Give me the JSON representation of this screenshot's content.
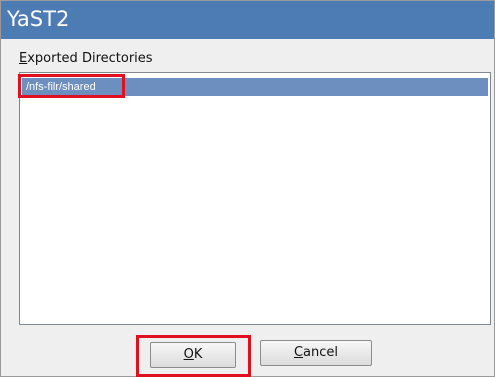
{
  "window": {
    "title": "YaST2"
  },
  "section": {
    "label_mnemonic": "E",
    "label_rest": "xported Directories"
  },
  "list": {
    "items": [
      {
        "label": "/nfs-filr/shared",
        "selected": true
      }
    ]
  },
  "buttons": {
    "ok_mnemonic": "O",
    "ok_rest": "K",
    "cancel_mnemonic": "C",
    "cancel_rest": "ancel"
  },
  "colors": {
    "titlebar": "#4d7bb3",
    "selection": "#6d8fbf",
    "highlight": "#e0101f"
  }
}
